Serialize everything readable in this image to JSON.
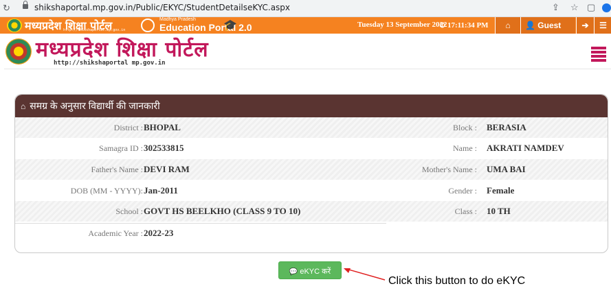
{
  "browser": {
    "url": "shikshaportal.mp.gov.in/Public/EKYC/StudentDetailseKYC.aspx"
  },
  "topbar": {
    "brand_small": "मध्यप्रदेश शिक्षा पोर्टल",
    "brand_small_url": "http://shikshaportal.mp.gov.in",
    "edu_state": "Madhya Pradesh",
    "edu_title": "Education Portal 2.0",
    "date": "Tuesday 13 September 2022",
    "time": "17:11:34 PM",
    "user_label": "Guest User",
    "colors": {
      "orange": "#f58220",
      "dark_orange": "#e0701a"
    }
  },
  "banner": {
    "brand": "मध्यप्रदेश शिक्षा पोर्टल",
    "url": "http://shikshaportal mp.gov.in",
    "accent": "#c2185b"
  },
  "card": {
    "title": "समग्र के अनुसार विद्यार्थी की जानकारी",
    "header_color": "#5a3431",
    "fields": {
      "district_label": "District :",
      "district": "BHOPAL",
      "block_label": "Block :",
      "block": "BERASIA",
      "samagra_label": "Samagra ID :",
      "samagra": "302533815",
      "name_label": "Name :",
      "name": "AKRATI NAMDEV",
      "father_label": "Father's Name :",
      "father": "DEVI RAM",
      "mother_label": "Mother's Name :",
      "mother": "UMA BAI",
      "dob_label": "DOB (MM - YYYY):",
      "dob": "Jan-2011",
      "gender_label": "Gender :",
      "gender": "Female",
      "school_label": "School :",
      "school": "GOVT HS BEELKHO (CLASS 9 TO 10)",
      "class_label": "Class :",
      "class": "10 TH",
      "year_label": "Academic Year :",
      "year": "2022-23"
    }
  },
  "ekyc": {
    "button_label": "eKYC करें",
    "button_color": "#5cb85c"
  },
  "annotation": {
    "text": "Click this button to do eKYC",
    "arrow_color": "#e02020"
  }
}
